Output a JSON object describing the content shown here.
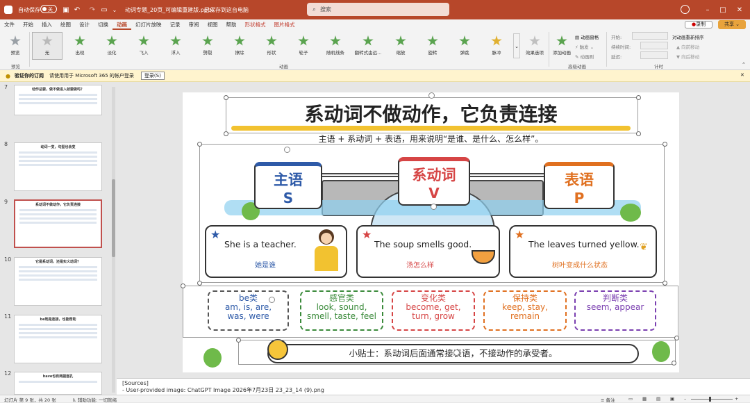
{
  "titlebar": {
    "autosave_label": "自动保存",
    "autosave_state": "关",
    "filename": "动词专题_20页_可编辑重建版.pptx",
    "save_status": "已保存到这台电脑",
    "search_placeholder": "搜索",
    "brand_color": "#b7472a"
  },
  "menu": {
    "tabs": [
      "文件",
      "开始",
      "插入",
      "绘图",
      "设计",
      "切换",
      "动画",
      "幻灯片放映",
      "记录",
      "审阅",
      "视图",
      "帮助",
      "形状格式",
      "图片格式"
    ],
    "active_tab": "动画",
    "record_button": "录制",
    "share_button": "共享"
  },
  "ribbon": {
    "preview_label": "预览",
    "effects": [
      "无",
      "出现",
      "淡化",
      "飞入",
      "浮入",
      "劈裂",
      "擦除",
      "形状",
      "轮子",
      "随机线条",
      "翻转式由远...",
      "缩放",
      "旋转",
      "弹跳",
      "脉冲"
    ],
    "effect_options_label": "效果选项",
    "add_animation_label": "添加动画",
    "animation_pane_label": "动画窗格",
    "trigger_label": "触发",
    "animation_painter_label": "动画刷",
    "start_label": "开始:",
    "duration_label": "持续时间:",
    "delay_label": "延迟:",
    "reorder_label": "对动画重新排序",
    "move_earlier_label": "向前移动",
    "move_later_label": "向后移动",
    "groups": {
      "preview": "预览",
      "animation": "动画",
      "advanced": "高级动画",
      "timing": "计时"
    }
  },
  "infobar": {
    "title": "验证你的订阅",
    "message": "请使用用于 Microsoft 365 的帐户登录",
    "button": "登录(S)"
  },
  "thumbnails": [
    {
      "num": "7",
      "title": "动作总要，做不做进入就要做吗？"
    },
    {
      "num": "8",
      "title": "动词一变，句型也会变"
    },
    {
      "num": "9",
      "title": "系动词不做动作，它负责连接"
    },
    {
      "num": "10",
      "title": "它是系动词，还是实义动词？"
    },
    {
      "num": "11",
      "title": "be既是连接，也能帮助"
    },
    {
      "num": "12",
      "title": "have也有两副面孔"
    }
  ],
  "slide": {
    "title": "系动词不做动作，它负责连接",
    "subtitle": "主语 + 系动词 + 表语，用来说明“是谁、是什么、怎么样”。",
    "signs": [
      {
        "cn": "主语",
        "letter": "S",
        "color": "#2e5aa8"
      },
      {
        "cn": "系动词",
        "letter": "V",
        "color": "#d64545"
      },
      {
        "cn": "表语",
        "letter": "P",
        "color": "#e07020"
      }
    ],
    "examples": [
      {
        "sentence": "She is a teacher.",
        "translation": "她是谁",
        "star_color": "#2e5aa8",
        "trans_color": "#2e5aa8"
      },
      {
        "sentence": "The soup smells good.",
        "translation": "汤怎么样",
        "star_color": "#d64545",
        "trans_color": "#d64545"
      },
      {
        "sentence": "The leaves turned yellow.",
        "translation": "树叶变成什么状态",
        "star_color": "#e07020",
        "trans_color": "#e07020"
      }
    ],
    "categories": [
      {
        "label": "be类",
        "words": "am, is, are, was, were",
        "color": "#2e5aa8"
      },
      {
        "label": "感官类",
        "words": "look, sound, smell, taste, feel",
        "color": "#3a8a3a"
      },
      {
        "label": "变化类",
        "words": "become, get, turn, grow",
        "color": "#d64545"
      },
      {
        "label": "保持类",
        "words": "keep, stay, remain",
        "color": "#e07020"
      },
      {
        "label": "判断类",
        "words": "seem, appear",
        "color": "#7a3fb0"
      }
    ],
    "tip": "小贴士：系动词后面通常接表语，不接动作的承受者。"
  },
  "notes": {
    "line1": "[Sources]",
    "line2": "- User-provided image: ChatGPT Image 2026年7月23日 23_23_14 (9).png"
  },
  "status": {
    "slide_info": "幻灯片 第 9 张，共 20 张",
    "accessibility": "辅助功能: 一切就绪",
    "notes_label": "备注"
  }
}
